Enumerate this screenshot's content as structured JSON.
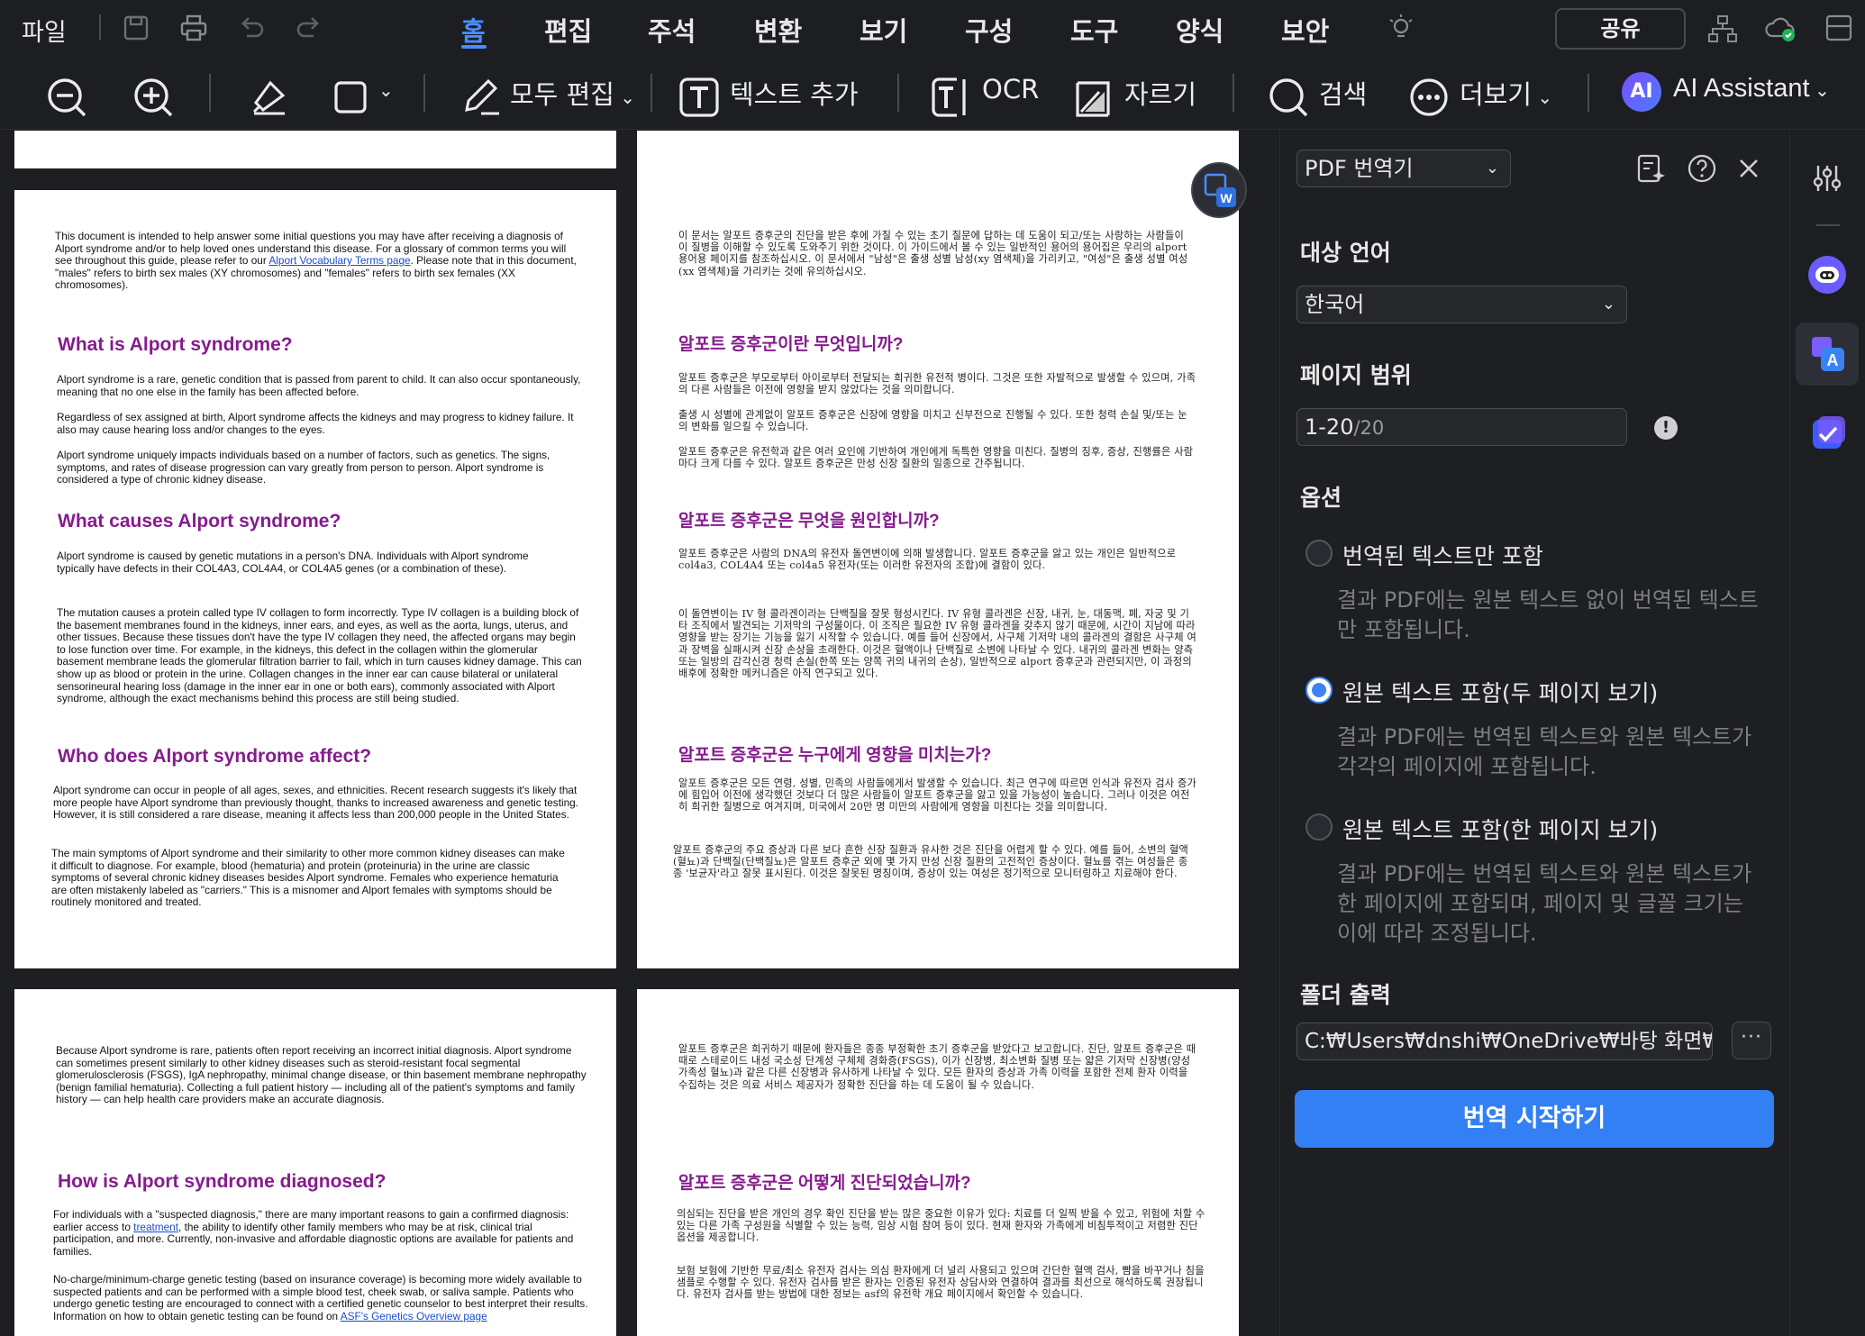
{
  "topbar": {
    "file_label": "파일",
    "menus": [
      "홈",
      "편집",
      "주석",
      "변환",
      "보기",
      "구성",
      "도구",
      "양식",
      "보안"
    ],
    "share_label": "공유"
  },
  "toolbar": {
    "edit_all": "모두 편집",
    "add_text": "텍스트 추가",
    "ocr": "OCR",
    "crop": "자르기",
    "search": "검색",
    "more": "더보기",
    "ai": "AI Assistant"
  },
  "doc_en": {
    "intro": "This document is intended to help answer some initial questions you may have after receiving a diagnosis of Alport syndrome and/or to help loved ones understand this disease. For a glossary of common terms you will see throughout this guide, please refer to our ",
    "intro_link": "Alport Vocabulary Terms page",
    "intro_end": ". Please note that in this document, \"males\" refers to birth sex males (XY chromosomes) and \"females\" refers to birth sex females (XX chromosomes).",
    "h1": "What is Alport syndrome?",
    "p1": "Alport syndrome is a rare, genetic condition that is passed from parent to child. It can also occur spontaneously, meaning that no one else in the family has been affected before.",
    "p2": "Regardless of sex assigned at birth, Alport syndrome affects the kidneys and may progress to kidney failure. It also may cause hearing loss and/or changes to the eyes.",
    "p3": "Alport syndrome uniquely impacts individuals based on a number of factors, such as genetics. The signs, symptoms, and rates of disease progression can vary greatly from person to person. Alport syndrome is considered a type of chronic kidney disease.",
    "h2": "What causes Alport syndrome?",
    "p4": "Alport syndrome is caused by genetic mutations in a person's DNA. Individuals with Alport syndrome typically have defects in their COL4A3, COL4A4, or COL4A5 genes (or a combination of these).",
    "p5": "The mutation causes a protein called type IV collagen to form incorrectly. Type IV collagen is a building block of the basement membranes found in the kidneys, inner ears, and eyes, as well as the aorta, lungs, uterus, and other tissues. Because these tissues don't have the type IV collagen they need, the affected organs may begin to lose function over time. For example, in the kidneys, this defect in the collagen within the glomerular basement membrane leads the glomerular filtration barrier to fail, which in turn causes kidney damage. This can show up as blood or protein in the urine. Collagen changes in the inner ear can cause bilateral or unilateral sensorineural hearing loss (damage in the inner ear in one or both ears), commonly associated with Alport syndrome, although the exact mechanisms behind this process are still being studied.",
    "h3": "Who does Alport syndrome affect?",
    "p6": "Alport syndrome can occur in people of all ages, sexes, and ethnicities. Recent research suggests it's likely that more people have Alport syndrome than previously thought, thanks to increased awareness and genetic testing. However, it is still considered a rare disease, meaning it affects less than 200,000 people in the United States.",
    "p7": "The main symptoms of Alport syndrome and their similarity to other more common kidney diseases can make it difficult to diagnose. For example, blood (hematuria) and protein (proteinuria) in the urine are classic symptoms of several chronic kidney diseases besides Alport syndrome. Females who experience hematuria are often mistakenly labeled as \"carriers.\" This is a misnomer and Alport females with symptoms should be routinely monitored and treated.",
    "p8": "Because Alport syndrome is rare, patients often report receiving an incorrect initial diagnosis. Alport syndrome can sometimes present similarly to other kidney diseases such as steroid-resistant focal segmental glomerulosclerosis (FSGS), IgA nephropathy, minimal change disease, or thin basement membrane nephropathy (benign familial hematuria). Collecting a full patient history — including all of the patient's symptoms and family history — can help health care providers make an accurate diagnosis.",
    "h4": "How is Alport syndrome diagnosed?",
    "p9a": "For individuals with a \"suspected diagnosis,\" there are many important reasons to gain a confirmed diagnosis: earlier access to ",
    "p9link": "treatment",
    "p9b": ", the ability to identify other family members who may be at risk, clinical trial participation, and more. Currently, non-invasive and affordable diagnostic options are available for patients and families.",
    "p10": "No-charge/minimum-charge genetic testing (based on insurance coverage) is becoming more widely available to suspected patients and can be performed with a simple blood test, cheek swab, or saliva sample. Patients who undergo genetic testing are encouraged to connect with a certified genetic counselor to best interpret their results. Information on how to obtain genetic testing can be found on ",
    "p10link": "ASF's Genetics Overview page"
  },
  "doc_ko": {
    "intro": "이 문서는 알포트 증후군의 진단을 받은 후에 가질 수 있는 초기 질문에 답하는 데 도움이 되고/또는 사랑하는 사람들이 이 질병을 이해할 수 있도록 도와주기 위한 것이다. 이 가이드에서 볼 수 있는 일반적인 용어의 용어집은 우리의 alport 용어용 페이지를 참조하십시오. 이 문서에서 \"남성\"은 출생 성별 남성(xy 염색체)을 가리키고, \"여성\"은 출생 성별 여성(xx 염색체)을 가리키는 것에 유의하십시오.",
    "h1": "알포트 증후군이란 무엇입니까?",
    "p1": "알포트 증후군은 부모로부터 아이로부터 전달되는 희귀한 유전적 병이다. 그것은 또한 자발적으로 발생할 수 있으며, 가족의 다른 사람들은 이전에 영향을 받지 않았다는 것을 의미합니다.",
    "p2": "출생 시 성별에 관계없이 알포트 증후군은 신장에 영향을 미치고 신부전으로 진행될 수 있다. 또한 청력 손실 및/또는 눈의 변화를 일으킬 수 있습니다.",
    "p3": "알포트 증후군은 유전학과 같은 여러 요인에 기반하여 개인에게 독특한 영향을 미친다. 질병의 징후, 증상, 진행률은 사람마다 크게 다를 수 있다. 알포트 증후군은 만성 신장 질환의 일종으로 간주됩니다.",
    "h2": "알포트 증후군은 무엇을 원인합니까?",
    "p4": "알포트 증후군은 사람의 DNA의 유전자 돌연변이에 의해 발생합니다. 알포트 증후군을 앓고 있는 개인은 일반적으로 col4a3, COL4A4 또는 col4a5 유전자(또는 이러한 유전자의 조합)에 결함이 있다.",
    "p5": "이 돌연변이는 IV 형 콜라겐이라는 단백질을 잘못 형성시킨다. IV 유형 콜라겐은 신장, 내귀, 눈, 대동맥, 폐, 자궁 및 기타 조직에서 발견되는 기저막의 구성물이다. 이 조직은 필요한 IV 유형 콜라겐을 갖추지 않기 때문에, 시간이 지남에 따라 영향을 받는 장기는 기능을 잃기 시작할 수 있습니다. 예를 들어 신장에서, 사구체 기저막 내의 콜라겐의 결함은 사구체 여과 장벽을 실패시켜 신장 손상을 초래한다. 이것은 혈액이나 단백질로 소변에 나타날 수 있다. 내귀의 콜라겐 변화는 양측 또는 일방의 감각신경 청력 손실(한쪽 또는 양쪽 귀의 내귀의 손상), 일반적으로 alport 증후군과 관련되지만, 이 과정의 배후에 정확한 메커니즘은 아직 연구되고 있다.",
    "h3": "알포트 증후군은 누구에게 영향을 미치는가?",
    "p6": "알포트 증후군은 모든 연령, 성별, 민족의 사람들에게서 발생할 수 있습니다. 최근 연구에 따르면 인식과 유전자 검사 증가에 힘입어 이전에 생각했던 것보다 더 많은 사람들이 알포트 증후군을 앓고 있을 가능성이 높습니다. 그러나 이것은 여전히 희귀한 질병으로 여겨지며, 미국에서 20만 명 미만의 사람에게 영향을 미친다는 것을 의미합니다.",
    "p7": "알포트 증후군의 주요 증상과 다른 보다 흔한 신장 질환과 유사한 것은 진단을 어렵게 할 수 있다. 예를 들어, 소변의 혈액(혈뇨)과 단백질(단백질뇨)은 알포트 증후군 외에 몇 가지 만성 신장 질환의 고전적인 증상이다. 혈뇨를 겪는 여성들은 종종 '보균자'라고 잘못 표시된다. 이것은 잘못된 명칭이며, 증상이 있는 여성은 정기적으로 모니터링하고 치료해야 한다.",
    "p8": "알포트 증후군은 희귀하기 때문에 환자들은 종종 부정확한 초기 증후군을 받았다고 보고합니다. 진단, 알포트 증후군은 때때로 스테로이드 내성 국소성 단계성 구체체 경화증(FSGS), 이가 신장병, 최소변화 질병 또는 얇은 기저막 신장병(양성 가족성 혈뇨)과 같은 다른 신장병과 유사하게 나타날 수 있다. 모든 환자의 증상과 가족 이력을 포함한 전체 환자 이력을 수집하는 것은 의료 서비스 제공자가 정확한 진단을 하는 데 도움이 될 수 있습니다.",
    "h4": "알포트 증후군은 어떻게 진단되었습니까?",
    "p9": "의심되는 진단을 받은 개인의 경우 확인 진단을 받는 많은 중요한 이유가 있다: 치료를 더 일찍 받을 수 있고, 위험에 처할 수 있는 다른 가족 구성원을 식별할 수 있는 능력, 임상 시험 참여 등이 있다. 현재 환자와 가족에게 비침투적이고 저렴한 진단 옵션을 제공합니다.",
    "p10": "보험 보험에 기반한 무료/최소 유전자 검사는 의심 환자에게 더 널리 사용되고 있으며 간단한 혈액 검사, 뺨을 바꾸거나 침을 샘플로 수행할 수 있다. 유전자 검사를 받은 환자는 인증된 유전자 상담사와 연결하여 결과를 최선으로 해석하도록 권장됩니다. 유전자 검사를 받는 방법에 대한 정보는 asf의 유전학 개요 페이지에서 확인할 수 있습니다."
  },
  "panel": {
    "tool_select": "PDF 번역기",
    "target_lang_title": "대상 언어",
    "target_lang": "한국어",
    "range_title": "페이지 범위",
    "range_value": "1-20",
    "range_total": "/20",
    "options_title": "옵션",
    "opt1_label": "번역된 텍스트만 포함",
    "opt1_desc": "결과 PDF에는 원본 텍스트 없이 번역된 텍스트만 포함됩니다.",
    "opt2_label": "원본 텍스트 포함(두 페이지 보기)",
    "opt2_desc": "결과 PDF에는 번역된 텍스트와 원본 텍스트가 각각의 페이지에 포함됩니다.",
    "opt3_label": "원본 텍스트 포함(한 페이지 보기)",
    "opt3_desc": "결과 PDF에는 번역된 텍스트와 원본 텍스트가 한 페이지에 포함되며, 페이지 및 글꼴 크기는 이에 따라 조정됩니다.",
    "folder_title": "폴더 출력",
    "folder_path": "C:₩Users₩dnshi₩OneDrive₩바탕 화면₩PDF",
    "start_button": "번역 시작하기",
    "selected_option": 2
  },
  "colors": {
    "accent": "#3380f5",
    "heading": "#861b8f",
    "bg": "#1e1f23"
  }
}
